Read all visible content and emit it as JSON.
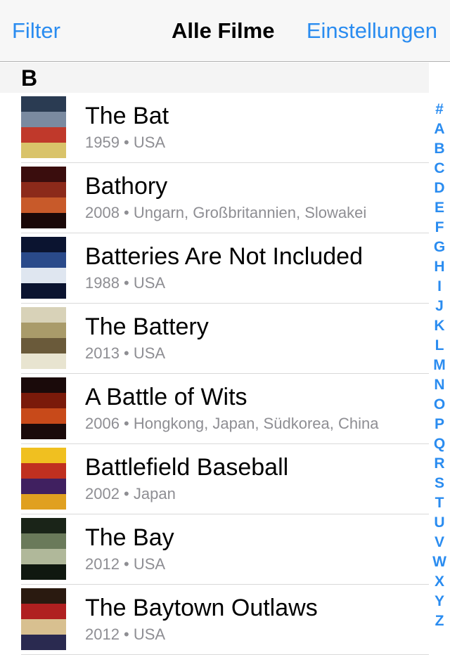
{
  "nav": {
    "left_label": "Filter",
    "title": "Alle Filme",
    "right_label": "Einstellungen"
  },
  "section": {
    "letter": "B"
  },
  "movies": [
    {
      "title": "The Bat",
      "subtitle": "1959 • USA",
      "poster_colors": [
        "#2a3b52",
        "#7a8aa0",
        "#c0392b",
        "#d9c36a"
      ]
    },
    {
      "title": "Bathory",
      "subtitle": "2008 • Ungarn, Großbritannien, Slowakei",
      "poster_colors": [
        "#3a0d0d",
        "#8c2a1a",
        "#c85a2a",
        "#1a0808"
      ]
    },
    {
      "title": "Batteries Are Not Included",
      "subtitle": "1988 • USA",
      "poster_colors": [
        "#0b1430",
        "#2a4a8a",
        "#dfe6f0",
        "#0b1430"
      ]
    },
    {
      "title": "The Battery",
      "subtitle": "2013 • USA",
      "poster_colors": [
        "#d8d2b8",
        "#a99b6a",
        "#6a5a3a",
        "#e8e4d0"
      ]
    },
    {
      "title": "A Battle of Wits",
      "subtitle": "2006 • Hongkong, Japan, Südkorea, China",
      "poster_colors": [
        "#1a0a0a",
        "#7a1a0a",
        "#c84a1a",
        "#1a0a0a"
      ]
    },
    {
      "title": "Battlefield Baseball",
      "subtitle": "2002 • Japan",
      "poster_colors": [
        "#f0c020",
        "#c03020",
        "#402060",
        "#e0a020"
      ]
    },
    {
      "title": "The Bay",
      "subtitle": "2012 • USA",
      "poster_colors": [
        "#1a2418",
        "#6a7a5a",
        "#b0b89a",
        "#101810"
      ]
    },
    {
      "title": "The Baytown Outlaws",
      "subtitle": "2012 • USA",
      "poster_colors": [
        "#2a1a10",
        "#b02020",
        "#d8c090",
        "#2a2a50"
      ]
    }
  ],
  "index_letters": [
    "#",
    "A",
    "B",
    "C",
    "D",
    "E",
    "F",
    "G",
    "H",
    "I",
    "J",
    "K",
    "L",
    "M",
    "N",
    "O",
    "P",
    "Q",
    "R",
    "S",
    "T",
    "U",
    "V",
    "W",
    "X",
    "Y",
    "Z"
  ]
}
